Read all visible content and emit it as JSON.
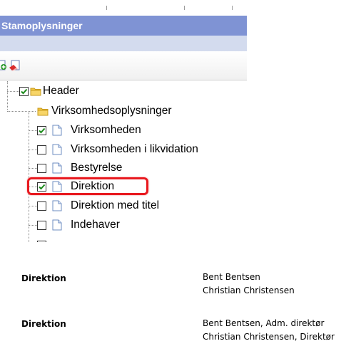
{
  "window": {
    "title": "Stamoplysninger"
  },
  "toolbar": {
    "buttons": [
      {
        "icon": "add-document-icon"
      },
      {
        "icon": "remove-document-icon"
      }
    ]
  },
  "tree": {
    "items": [
      {
        "label": "Header",
        "level": 1,
        "checkbox": true,
        "checked": true,
        "icon": "folder-icon"
      },
      {
        "label": "Virksomhedsoplysninger",
        "level": 1,
        "checkbox": false,
        "checked": false,
        "icon": "folder-icon"
      },
      {
        "label": "Virksomheden",
        "level": 2,
        "checkbox": true,
        "checked": true,
        "icon": "document-icon"
      },
      {
        "label": "Virksomheden i likvidation",
        "level": 2,
        "checkbox": true,
        "checked": false,
        "icon": "document-icon"
      },
      {
        "label": "Bestyrelse",
        "level": 2,
        "checkbox": true,
        "checked": false,
        "icon": "document-icon"
      },
      {
        "label": "Direktion",
        "level": 2,
        "checkbox": true,
        "checked": true,
        "icon": "document-icon",
        "highlighted": true
      },
      {
        "label": "Direktion med titel",
        "level": 2,
        "checkbox": true,
        "checked": false,
        "icon": "document-icon"
      },
      {
        "label": "Indehaver",
        "level": 2,
        "checkbox": true,
        "checked": false,
        "icon": "document-icon"
      }
    ]
  },
  "output": [
    {
      "key": "Direktion",
      "lines": [
        "Bent Bentsen",
        "Christian Christensen"
      ]
    },
    {
      "key": "Direktion",
      "lines": [
        "Bent Bentsen, Adm. direktør",
        "Christian Christensen, Direktør"
      ]
    }
  ],
  "colors": {
    "titlebar": "#7f93d4",
    "subbar": "#d3dbee",
    "highlight": "#e8191f",
    "check": "#1a8a1a"
  }
}
